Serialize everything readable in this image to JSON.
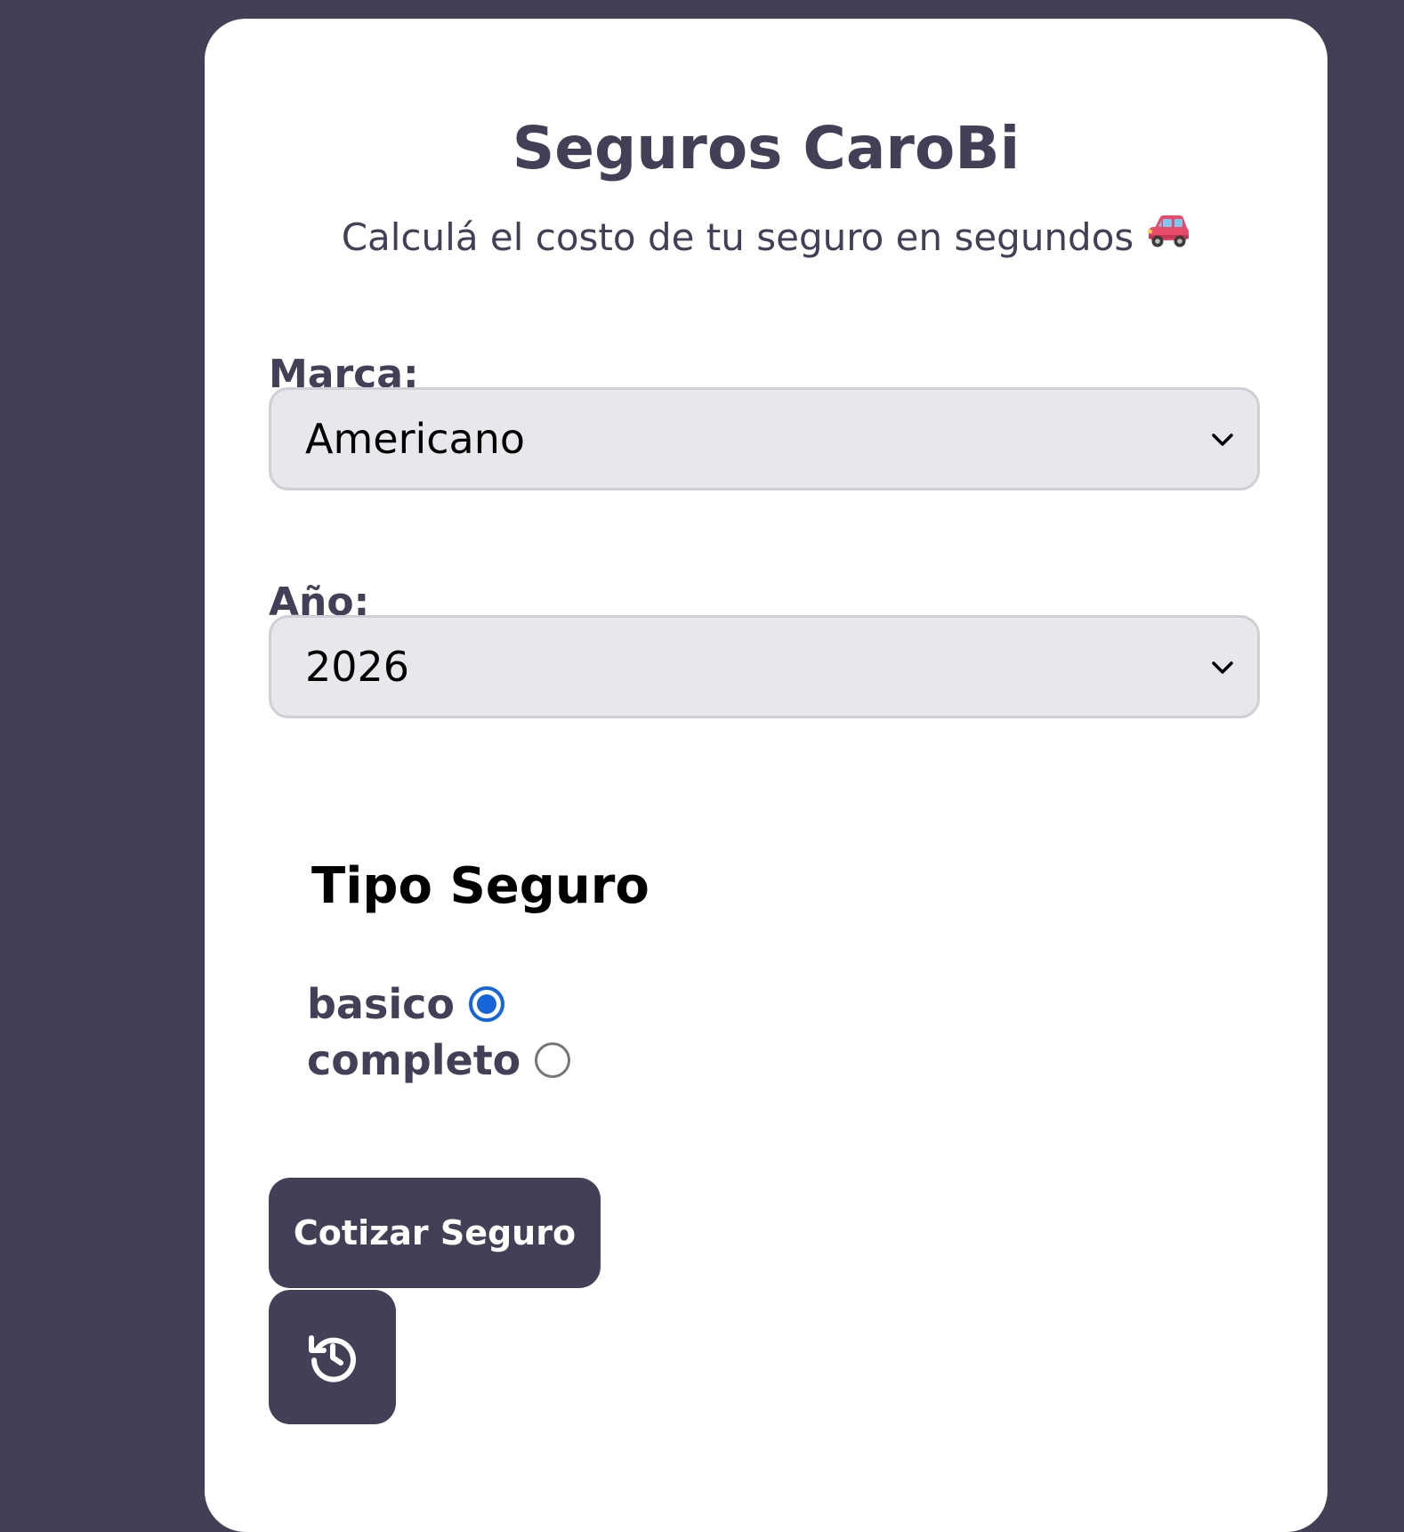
{
  "header": {
    "title": "Seguros CaroBi",
    "subtitle": "Calculá el costo de tu seguro en segundos",
    "subtitle_icon": "car-icon"
  },
  "form": {
    "brand": {
      "label": "Marca:",
      "selected": "Americano"
    },
    "year": {
      "label": "Año:",
      "selected": "2026"
    },
    "insurance_type": {
      "title": "Tipo Seguro",
      "options": [
        {
          "label": "basico",
          "checked": true
        },
        {
          "label": "completo",
          "checked": false
        }
      ]
    },
    "submit_label": "Cotizar Seguro",
    "history_icon": "history-icon"
  },
  "colors": {
    "background": "#433f57",
    "card": "#ffffff",
    "primary": "#433f57",
    "select_bg": "#e8e8ec",
    "radio_accent": "#1565d8"
  }
}
